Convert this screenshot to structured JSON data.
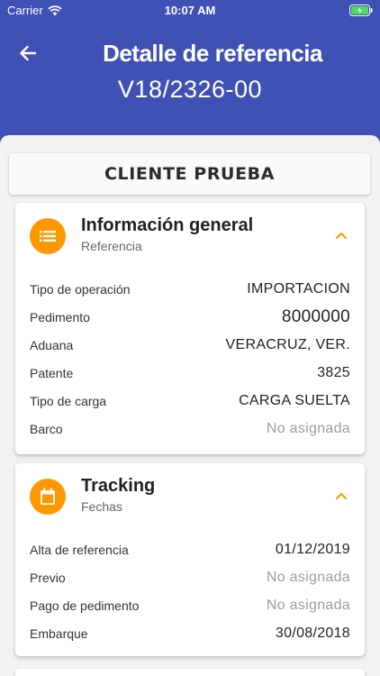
{
  "status_bar": {
    "carrier": "Carrier",
    "time": "10:07 AM"
  },
  "header": {
    "title": "Detalle de referencia",
    "reference": "V18/2326-00"
  },
  "client": {
    "name": "CLIENTE PRUEBA"
  },
  "general": {
    "title": "Información general",
    "subtitle": "Referencia",
    "icon": "list-icon",
    "rows": [
      {
        "label": "Tipo de operación",
        "value": "IMPORTACION"
      },
      {
        "label": "Pedimento",
        "value": "8000000"
      },
      {
        "label": "Aduana",
        "value": "VERACRUZ, VER."
      },
      {
        "label": "Patente",
        "value": "3825"
      },
      {
        "label": "Tipo de carga",
        "value": "CARGA SUELTA"
      },
      {
        "label": "Barco",
        "value": "No asignada"
      }
    ]
  },
  "tracking": {
    "title": "Tracking",
    "subtitle": "Fechas",
    "icon": "calendar-icon",
    "rows": [
      {
        "label": "Alta de referencia",
        "value": "01/12/2019"
      },
      {
        "label": "Previo",
        "value": "No asignada"
      },
      {
        "label": "Pago de pedimento",
        "value": "No asignada"
      },
      {
        "label": "Embarque",
        "value": "30/08/2018"
      }
    ]
  },
  "colors": {
    "header": "#3f51b5",
    "accent": "#ff9800",
    "muted": "#9e9e9e"
  }
}
